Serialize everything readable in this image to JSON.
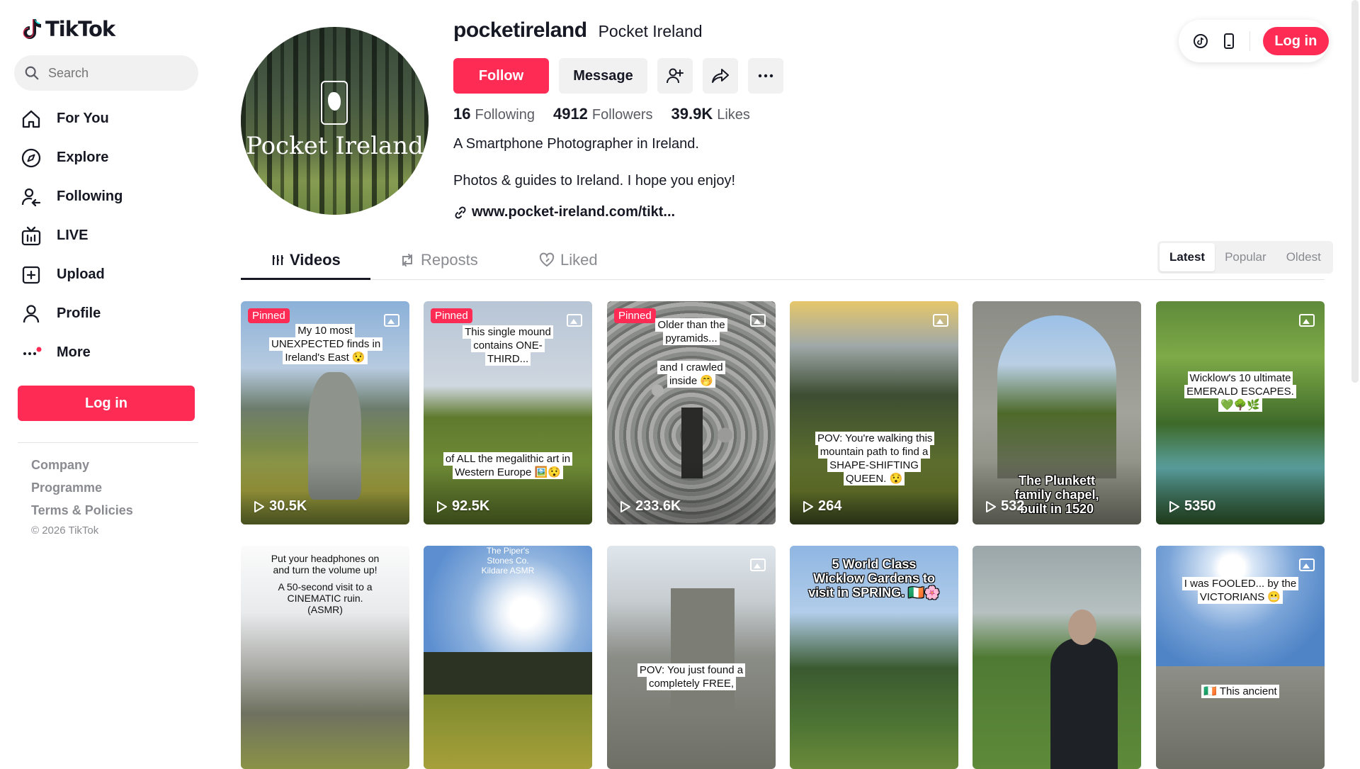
{
  "sidebar": {
    "logo": "TikTok",
    "search_placeholder": "Search",
    "nav": [
      {
        "label": "For You",
        "icon": "home-icon"
      },
      {
        "label": "Explore",
        "icon": "compass-icon"
      },
      {
        "label": "Following",
        "icon": "following-icon"
      },
      {
        "label": "LIVE",
        "icon": "live-icon"
      },
      {
        "label": "Upload",
        "icon": "upload-icon"
      },
      {
        "label": "Profile",
        "icon": "profile-icon"
      },
      {
        "label": "More",
        "icon": "more-icon"
      }
    ],
    "login_label": "Log in",
    "footer": {
      "company": "Company",
      "programme": "Programme",
      "terms": "Terms & Policies",
      "copyright": "© 2026 TikTok"
    }
  },
  "profile": {
    "avatar_text": "Pocket Ireland",
    "username": "pocketireland",
    "display_name": "Pocket Ireland",
    "follow_label": "Follow",
    "message_label": "Message",
    "stats": {
      "following_count": "16",
      "following_label": "Following",
      "followers_count": "4912",
      "followers_label": "Followers",
      "likes_count": "39.9K",
      "likes_label": "Likes"
    },
    "bio_line1": "A Smartphone Photographer in Ireland.",
    "bio_line2": "Photos & guides to Ireland. I hope you enjoy!",
    "link": "www.pocket-ireland.com/tikt..."
  },
  "topbar": {
    "login_label": "Log in"
  },
  "tabs": {
    "videos": "Videos",
    "reposts": "Reposts",
    "liked": "Liked"
  },
  "sort": {
    "latest": "Latest",
    "popular": "Popular",
    "oldest": "Oldest"
  },
  "pinned_label": "Pinned",
  "videos": [
    {
      "views": "30.5K",
      "caption": "My 10 most UNEXPECTED finds in Ireland's East 😯",
      "caption2": ""
    },
    {
      "views": "92.5K",
      "caption": "This single mound contains ONE-THIRD...",
      "caption2": "of ALL the megalithic art in Western Europe 🖼️😯"
    },
    {
      "views": "233.6K",
      "caption": "Older than the pyramids...",
      "caption2": "and I crawled inside 🤭"
    },
    {
      "views": "264",
      "caption": "POV: You're walking this mountain path to find a SHAPE-SHIFTING QUEEN. 😯",
      "caption2": ""
    },
    {
      "views": "532",
      "caption": "The Plunkett family chapel, built in 1520",
      "caption2": ""
    },
    {
      "views": "5350",
      "caption": "Wicklow's 10 ultimate EMERALD ESCAPES. 💚🌳🌿",
      "caption2": ""
    },
    {
      "views": "",
      "caption": "Put your headphones on and turn the volume up!",
      "caption2": "A 50-second visit to a CINEMATIC ruin. (ASMR)"
    },
    {
      "views": "",
      "caption": "The Piper's Stones Co. Kildare ASMR",
      "caption2": ""
    },
    {
      "views": "",
      "caption": "POV: You just found a completely FREE,",
      "caption2": ""
    },
    {
      "views": "",
      "caption": "5 World Class Wicklow Gardens to visit in SPRING. 🇮🇪🌸",
      "caption2": ""
    },
    {
      "views": "",
      "caption": "",
      "caption2": ""
    },
    {
      "views": "",
      "caption": "I was FOOLED... by the VICTORIANS 😬",
      "caption2": "🇮🇪 This ancient"
    }
  ]
}
